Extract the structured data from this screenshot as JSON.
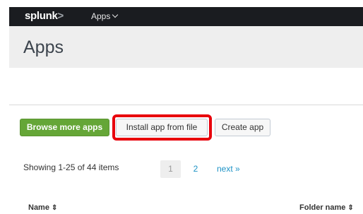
{
  "header": {
    "logo_text": "splunk",
    "logo_mark": ">",
    "apps_menu_label": "Apps"
  },
  "page": {
    "title": "Apps"
  },
  "toolbar": {
    "browse_label": "Browse more apps",
    "install_label": "Install app from file",
    "create_label": "Create app"
  },
  "pagination": {
    "summary": "Showing 1-25 of 44 items",
    "pages": [
      "1",
      "2"
    ],
    "current_page": "1",
    "next_label": "next »"
  },
  "table": {
    "columns": [
      {
        "label": "Name",
        "sort_icon": "⇕"
      },
      {
        "label": "Folder name",
        "sort_icon": "⇕"
      }
    ]
  },
  "colors": {
    "topbar": "#1a1c20",
    "title_bar": "#eeeeee",
    "primary_button": "#65a637",
    "highlight": "#e8000b",
    "link": "#1e93c6"
  },
  "icons": {
    "apps_menu": "chevron-down-icon",
    "sort": "sort-icon"
  }
}
